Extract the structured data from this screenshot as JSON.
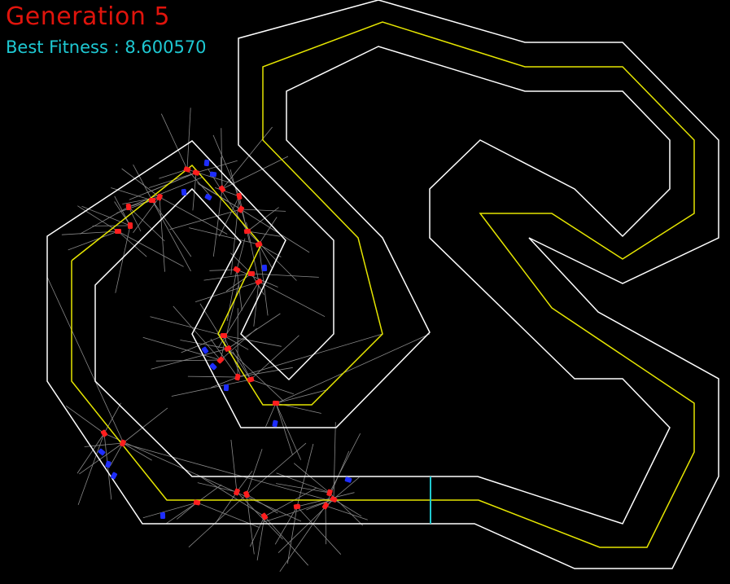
{
  "hud": {
    "generation_label": "Generation 5",
    "fitness_label": "Best Fitness : 8.600570"
  },
  "colors": {
    "background": "#000000",
    "track_border": "#ffffff",
    "center_line": "#e6e600",
    "finish_line": "#20c8d0",
    "generation_text": "#e0140c",
    "fitness_text": "#1ec8d2",
    "sensor_ray": "#888888",
    "car_alive": "#ff1e1e",
    "car_dead": "#1e2dff"
  },
  "objects": {
    "outer_track_border": "track-outer-wall",
    "inner_track_border": "track-inner-wall",
    "racing_line": "track-center-line",
    "finish_line": "start-finish-line",
    "cars": "population-cars",
    "sensors": "car-sensor-rays"
  }
}
